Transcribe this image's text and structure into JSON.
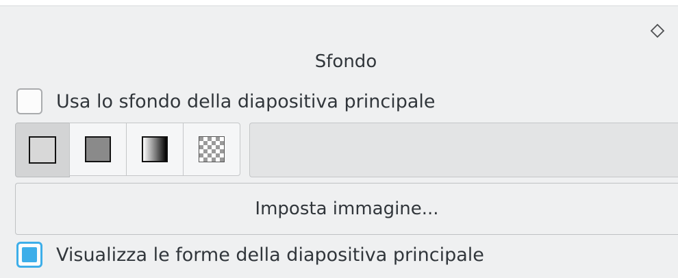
{
  "panel": {
    "title": "Sfondo",
    "pin_icon": "diamond-pin-icon"
  },
  "use_master_background": {
    "label": "Usa lo sfondo della diapositiva principale",
    "checked": false
  },
  "fill_types": [
    {
      "name": "none",
      "icon": "no-fill-icon",
      "selected": true
    },
    {
      "name": "color",
      "icon": "solid-color-icon",
      "selected": false
    },
    {
      "name": "gradient",
      "icon": "gradient-icon",
      "selected": false
    },
    {
      "name": "pattern",
      "icon": "pattern-icon",
      "selected": false
    }
  ],
  "set_image_button": {
    "label": "Imposta immagine..."
  },
  "show_master_shapes": {
    "label": "Visualizza le forme della diapositiva principale",
    "checked": true
  },
  "colors": {
    "accent": "#3daee9",
    "panel_bg": "#eff0f1"
  }
}
